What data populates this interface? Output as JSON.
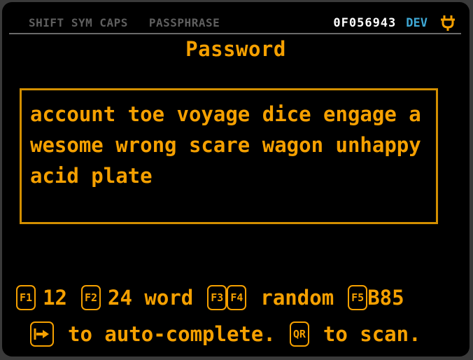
{
  "status": {
    "shift": "SHIFT",
    "sym": "SYM",
    "caps": "CAPS",
    "passphrase": "PASSPHRASE",
    "fingerprint": "0F056943",
    "mode": "DEV",
    "power_icon": "plug-icon",
    "colors": {
      "inactive": "#5f5f5f",
      "fingerprint": "#ffffff",
      "mode": "#3fa9d6",
      "accent": "#f5a000"
    }
  },
  "title": "Password",
  "password_field": {
    "value": "account toe voyage dice engage awesome wrong scare wagon unhappy acid plate"
  },
  "help": {
    "f1_key": "F1",
    "f1_text": "12",
    "f2_key": "F2",
    "f2_text": "24 word",
    "f3_key": "F3",
    "f4_key": "F4",
    "f3_f4_text": "random",
    "f5_key": "F5",
    "f5_text": "B85",
    "tab_icon": "tab-arrow-icon",
    "tab_text": "to auto-complete.",
    "qr_key": "QR",
    "qr_text": "to scan."
  }
}
